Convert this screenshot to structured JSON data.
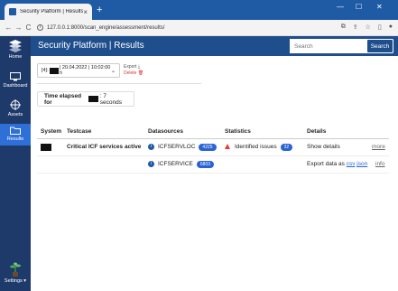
{
  "browser": {
    "tab_title": "Security Platform | Results",
    "tab_close": "×",
    "new_tab": "+",
    "url": "127.0.0.1:8000/scan_engine/assessment/results/",
    "win_min": "—",
    "win_max": "☐",
    "win_close": "✕"
  },
  "sidebar": {
    "home": "Home",
    "dashboard": "Dashboard",
    "assets": "Assets",
    "results": "Results",
    "settings": "Settings ▾"
  },
  "header": {
    "title": "Security Platform | Results",
    "search_placeholder": "Search",
    "search_button": "Search"
  },
  "run": {
    "prefix": "[4]:",
    "date": "| 20.04.2022 | 10:02:00 h",
    "export": "Export",
    "delete": "Delete"
  },
  "elapsed": {
    "label": "Time elapsed for",
    "value": ": 7 seconds"
  },
  "table": {
    "headers": {
      "system": "System",
      "testcase": "Testcase",
      "datasources": "Datasources",
      "statistics": "Statistics",
      "details": "Details"
    },
    "row": {
      "testcase": "Critical ICF services active",
      "ds1_name": "ICFSERVLOC",
      "ds1_count": "4225",
      "ds2_name": "ICFSERVICE",
      "ds2_count": "6803",
      "stat_label": "Identified issues",
      "stat_count": "32",
      "show_details": "Show details",
      "more": "more",
      "export_prefix": "Export data as",
      "csv": "csv",
      "json": "json",
      "info": "info"
    }
  },
  "colors": {
    "titlebar": "#1f5aa5",
    "sidebar": "#1e3a6b",
    "appbar": "#1f4e8c",
    "accent": "#2a63d6",
    "danger": "#e63b2e"
  }
}
